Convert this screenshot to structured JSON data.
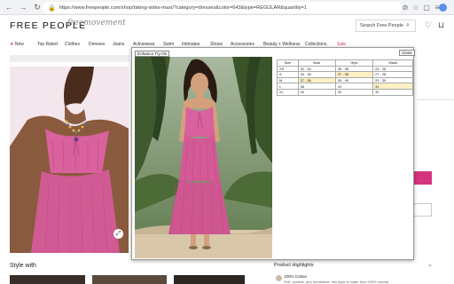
{
  "browser": {
    "back": "←",
    "forward": "→",
    "reload": "↻",
    "url": "https://www.freepeople.com/shop/taking-sides-maxi/?category=dresses&color=643&type=REGULAR&quantity=1",
    "lock": "🔒",
    "icons": [
      "⊘",
      "☆",
      "▢",
      "≡"
    ]
  },
  "header": {
    "logo": "FREE PEOPLE",
    "script_logo": "freemovement",
    "search_placeholder": "Search Free People",
    "search_icon": "⌕",
    "heart_icon": "♡",
    "bag_icon": "⊔"
  },
  "nav": {
    "items": [
      {
        "label": "New",
        "star": "★"
      },
      {
        "label": "Top Rated"
      },
      {
        "label": "Clothes"
      },
      {
        "label": "Dresses"
      },
      {
        "label": "Jeans"
      },
      {
        "label": "Activewear"
      },
      {
        "label": "Swim"
      },
      {
        "label": "Intimates"
      },
      {
        "label": "Shoes"
      },
      {
        "label": "Accessories"
      },
      {
        "label": "Beauty + Wellness"
      },
      {
        "label": "Collections"
      },
      {
        "label": "Sale",
        "sale": true
      }
    ]
  },
  "page": {
    "style_with": "Style with",
    "product_highlights": "Product Highlights",
    "highlight_title": "100% Cotton",
    "highlight_body": "Soft, durable, and breathable, this style is made from 100% natural",
    "zoom_icon": "⤢",
    "chevron": "⌄"
  },
  "modal": {
    "title": "Enhance Try-On",
    "close": "Close",
    "table": {
      "headers": [
        "Size",
        "Bust",
        "Hips",
        "Waist"
      ],
      "rows": [
        [
          "XS",
          "32 - 34",
          "35 - 36",
          "24 - 25"
        ],
        [
          "S",
          "34 - 36",
          "37 - 38",
          "27 - 28"
        ],
        [
          "M",
          "37 - 38",
          "39 - 40",
          "29 - 30"
        ],
        [
          "L",
          "38",
          "41",
          "31"
        ],
        [
          "XL",
          "40",
          "42",
          "32"
        ]
      ],
      "highlighted": [
        [
          1,
          2
        ],
        [
          2,
          1
        ],
        [
          3,
          3
        ]
      ]
    }
  },
  "colors": {
    "accent": "#d6337e",
    "highlight": "#fdf0c5",
    "dress": "#d9619d"
  }
}
